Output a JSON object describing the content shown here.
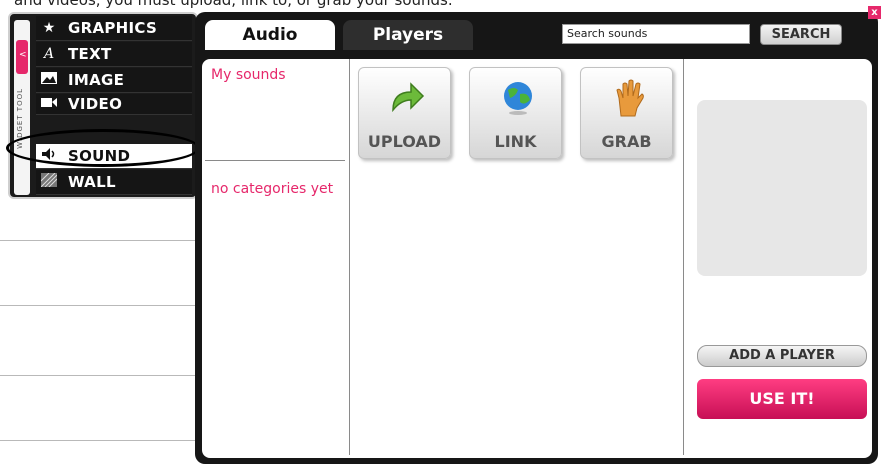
{
  "caption": "and videos, you must upload, link to, or grab your sounds.",
  "toolpanel": {
    "handle_tab": "<",
    "handle_label": "WIDGET TOOL",
    "items": [
      {
        "label": "GRAPHICS",
        "icon": "star-icon"
      },
      {
        "label": "TEXT",
        "icon": "text-a-icon"
      },
      {
        "label": "IMAGE",
        "icon": "image-icon"
      },
      {
        "label": "VIDEO",
        "icon": "video-icon"
      },
      {
        "label": "SOUND",
        "icon": "speaker-icon",
        "active": true
      },
      {
        "label": "WALL",
        "icon": "wall-pattern-icon"
      }
    ]
  },
  "dialog": {
    "close": "x",
    "tabs": [
      {
        "label": "Audio",
        "active": true
      },
      {
        "label": "Players",
        "active": false
      }
    ],
    "search": {
      "placeholder": "Search sounds",
      "value": "",
      "button": "SEARCH"
    },
    "left": {
      "my_sounds": "My sounds",
      "categories": "no categories yet"
    },
    "actions": [
      {
        "label": "UPLOAD",
        "icon": "green-arrow-icon"
      },
      {
        "label": "LINK",
        "icon": "globe-icon"
      },
      {
        "label": "GRAB",
        "icon": "hand-icon"
      }
    ],
    "right": {
      "add_player": "ADD A PLAYER",
      "use_it": "USE IT!"
    }
  },
  "colors": {
    "accent": "#e6286b",
    "dark": "#161616"
  }
}
